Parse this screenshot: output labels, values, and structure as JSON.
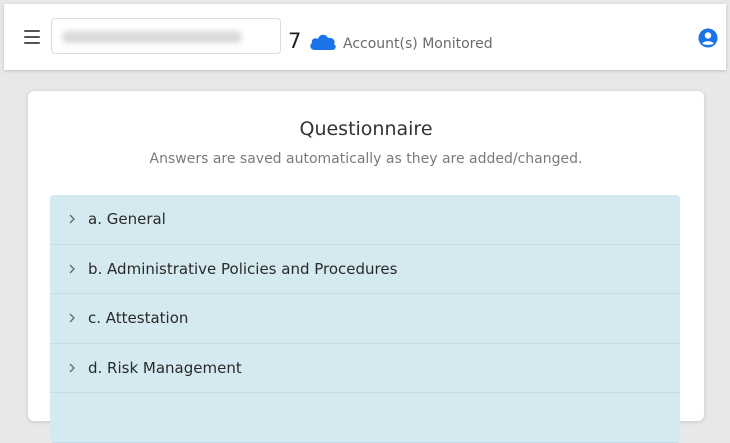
{
  "header": {
    "account_count": "7",
    "monitored_label": "Account(s) Monitored",
    "icons": {
      "menu": "hamburger-menu-icon",
      "cloud": "cloud-icon",
      "user": "user-circle-icon"
    },
    "colors": {
      "cloud": "#1a73e8",
      "user": "#1a73e8"
    }
  },
  "questionnaire": {
    "title": "Questionnaire",
    "subtitle": "Answers are saved automatically as they are added/changed.",
    "sections": [
      {
        "label": "a. General"
      },
      {
        "label": "b. Administrative Policies and Procedures"
      },
      {
        "label": "c. Attestation"
      },
      {
        "label": "d. Risk Management"
      },
      {
        "label": ""
      }
    ]
  }
}
